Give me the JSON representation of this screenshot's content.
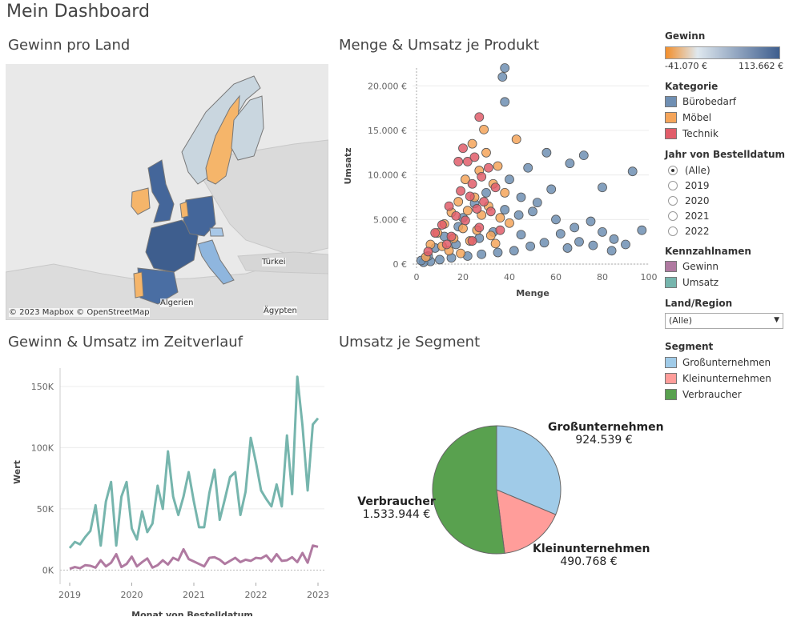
{
  "dashboard": {
    "title": "Mein Dashboard"
  },
  "map": {
    "title": "Gewinn pro Land",
    "attribution": "© 2023 Mapbox © OpenStreetMap",
    "labels": [
      "Türkei",
      "Algerien",
      "Ägypten"
    ]
  },
  "scatter": {
    "title": "Menge & Umsatz je Produkt",
    "chart_data": {
      "type": "scatter",
      "xlabel": "Menge",
      "ylabel": "Umsatz",
      "xlim": [
        0,
        100
      ],
      "ylim": [
        0,
        22000
      ],
      "xticks": [
        "0",
        "20",
        "40",
        "60",
        "80",
        "100"
      ],
      "yticks": [
        "0 €",
        "5.000 €",
        "10.000 €",
        "15.000 €",
        "20.000 €"
      ],
      "series": [
        {
          "name": "Bürobedarf",
          "color": "#6f8fb3",
          "points": [
            [
              38,
              22000
            ],
            [
              37,
              21000
            ],
            [
              38,
              18200
            ],
            [
              72,
              12200
            ],
            [
              66,
              11300
            ],
            [
              80,
              8600
            ],
            [
              93,
              10400
            ],
            [
              56,
              12500
            ],
            [
              48,
              10800
            ],
            [
              45,
              7500
            ],
            [
              38,
              6100
            ],
            [
              44,
              5500
            ],
            [
              50,
              5900
            ],
            [
              60,
              5000
            ],
            [
              75,
              4800
            ],
            [
              80,
              3600
            ],
            [
              85,
              2800
            ],
            [
              90,
              2200
            ],
            [
              97,
              3800
            ],
            [
              70,
              2500
            ],
            [
              65,
              1800
            ],
            [
              55,
              2400
            ],
            [
              49,
              2000
            ],
            [
              42,
              1500
            ],
            [
              35,
              1300
            ],
            [
              28,
              1100
            ],
            [
              22,
              900
            ],
            [
              15,
              700
            ],
            [
              10,
              500
            ],
            [
              6,
              300
            ],
            [
              3,
              200
            ],
            [
              52,
              6900
            ],
            [
              58,
              8400
            ],
            [
              40,
              9500
            ],
            [
              30,
              8000
            ],
            [
              25,
              6800
            ],
            [
              20,
              5200
            ],
            [
              18,
              4200
            ],
            [
              12,
              3100
            ],
            [
              8,
              1800
            ],
            [
              62,
              3400
            ],
            [
              68,
              4100
            ],
            [
              76,
              2100
            ],
            [
              84,
              1500
            ],
            [
              45,
              3300
            ],
            [
              33,
              3600
            ],
            [
              27,
              2900
            ],
            [
              17,
              2200
            ],
            [
              5,
              900
            ],
            [
              2,
              400
            ]
          ]
        },
        {
          "name": "Möbel",
          "color": "#f5a55a",
          "points": [
            [
              29,
              15100
            ],
            [
              43,
              14000
            ],
            [
              24,
              13500
            ],
            [
              30,
              12500
            ],
            [
              35,
              11000
            ],
            [
              27,
              10500
            ],
            [
              21,
              9500
            ],
            [
              33,
              9000
            ],
            [
              38,
              8000
            ],
            [
              25,
              7500
            ],
            [
              18,
              7000
            ],
            [
              31,
              6500
            ],
            [
              22,
              6000
            ],
            [
              15,
              5800
            ],
            [
              28,
              5500
            ],
            [
              36,
              5200
            ],
            [
              12,
              4500
            ],
            [
              20,
              4000
            ],
            [
              26,
              3800
            ],
            [
              9,
              3500
            ],
            [
              32,
              3200
            ],
            [
              16,
              2900
            ],
            [
              6,
              2200
            ],
            [
              11,
              2000
            ],
            [
              40,
              4600
            ],
            [
              14,
              1500
            ],
            [
              19,
              1200
            ],
            [
              4,
              800
            ],
            [
              23,
              2600
            ],
            [
              34,
              2300
            ]
          ]
        },
        {
          "name": "Technik",
          "color": "#e15d6a",
          "points": [
            [
              27,
              16500
            ],
            [
              20,
              13000
            ],
            [
              22,
              11500
            ],
            [
              25,
              12000
            ],
            [
              18,
              11500
            ],
            [
              31,
              10800
            ],
            [
              28,
              9800
            ],
            [
              24,
              9000
            ],
            [
              34,
              8600
            ],
            [
              19,
              8200
            ],
            [
              23,
              7600
            ],
            [
              29,
              7000
            ],
            [
              14,
              6500
            ],
            [
              26,
              6200
            ],
            [
              32,
              5900
            ],
            [
              17,
              5400
            ],
            [
              21,
              4900
            ],
            [
              11,
              4400
            ],
            [
              27,
              4100
            ],
            [
              8,
              3500
            ],
            [
              15,
              3100
            ],
            [
              36,
              3800
            ],
            [
              13,
              2200
            ],
            [
              24,
              2600
            ],
            [
              5,
              1400
            ]
          ]
        }
      ]
    }
  },
  "timeline": {
    "title": "Gewinn & Umsatz im Zeitverlauf",
    "chart_data": {
      "type": "line",
      "xlabel": "Monat von Bestelldatum",
      "ylabel": "Wert",
      "ylim": [
        -5000,
        165000
      ],
      "xticks": [
        "2019",
        "2020",
        "2021",
        "2022",
        "2023"
      ],
      "yticks": [
        "0K",
        "50K",
        "100K",
        "150K"
      ],
      "x_start": "2019-01",
      "series": [
        {
          "name": "Umsatz",
          "color": "#76b5ad",
          "values": [
            18000,
            23000,
            21000,
            27000,
            32000,
            53000,
            20000,
            56000,
            72000,
            20000,
            60000,
            72000,
            34000,
            25000,
            48000,
            31000,
            38000,
            69000,
            50000,
            97000,
            60000,
            45000,
            60000,
            80000,
            56000,
            35000,
            35000,
            63000,
            82000,
            41000,
            58000,
            76000,
            80000,
            45000,
            64000,
            108000,
            88000,
            65000,
            58000,
            52000,
            70000,
            52000,
            110000,
            62000,
            158000,
            118000,
            65000,
            119000,
            124000
          ]
        },
        {
          "name": "Gewinn",
          "color": "#b07aa1",
          "values": [
            1000,
            2500,
            1500,
            4000,
            3500,
            2000,
            8000,
            3000,
            6000,
            13000,
            2500,
            5000,
            11000,
            3000,
            6500,
            9500,
            2000,
            4000,
            8000,
            4500,
            10000,
            8000,
            17000,
            9000,
            7000,
            5000,
            3000,
            10000,
            10500,
            8500,
            5000,
            7500,
            10000,
            6500,
            8500,
            7500,
            10000,
            9500,
            12000,
            7000,
            13000,
            7500,
            8000,
            10500,
            6500,
            14000,
            6000,
            20000,
            19000,
            13000,
            13500
          ]
        }
      ]
    }
  },
  "segment": {
    "title": "Umsatz je Segment",
    "chart_data": {
      "type": "pie",
      "categories": [
        "Großunternehmen",
        "Kleinunternehmen",
        "Verbraucher"
      ],
      "values": [
        924539,
        490768,
        1533944
      ],
      "value_labels": [
        "924.539 €",
        "490.768 €",
        "1.533.944 €"
      ],
      "colors": [
        "#a0cbe8",
        "#ff9d9a",
        "#59a14f"
      ]
    }
  },
  "legend": {
    "gewinn": {
      "title": "Gewinn",
      "min_label": "-41.070 €",
      "max_label": "113.662 €",
      "color_low": "#f28e2b",
      "color_mid": "#dfe8ef",
      "color_high": "#3e5e8e"
    },
    "kategorie": {
      "title": "Kategorie",
      "items": [
        {
          "label": "Bürobedarf",
          "color": "#6f8fb3"
        },
        {
          "label": "Möbel",
          "color": "#f5a55a"
        },
        {
          "label": "Technik",
          "color": "#e15d6a"
        }
      ]
    },
    "jahr": {
      "title": "Jahr von Bestelldatum",
      "selected": "(Alle)",
      "options": [
        "(Alle)",
        "2019",
        "2020",
        "2021",
        "2022"
      ]
    },
    "kennzahlen": {
      "title": "Kennzahlnamen",
      "items": [
        {
          "label": "Gewinn",
          "color": "#b07aa1"
        },
        {
          "label": "Umsatz",
          "color": "#76b5ad"
        }
      ]
    },
    "land": {
      "title": "Land/Region",
      "value": "(Alle)"
    },
    "segment": {
      "title": "Segment",
      "items": [
        {
          "label": "Großunternehmen",
          "color": "#a0cbe8"
        },
        {
          "label": "Kleinunternehmen",
          "color": "#ff9d9a"
        },
        {
          "label": "Verbraucher",
          "color": "#59a14f"
        }
      ]
    }
  }
}
